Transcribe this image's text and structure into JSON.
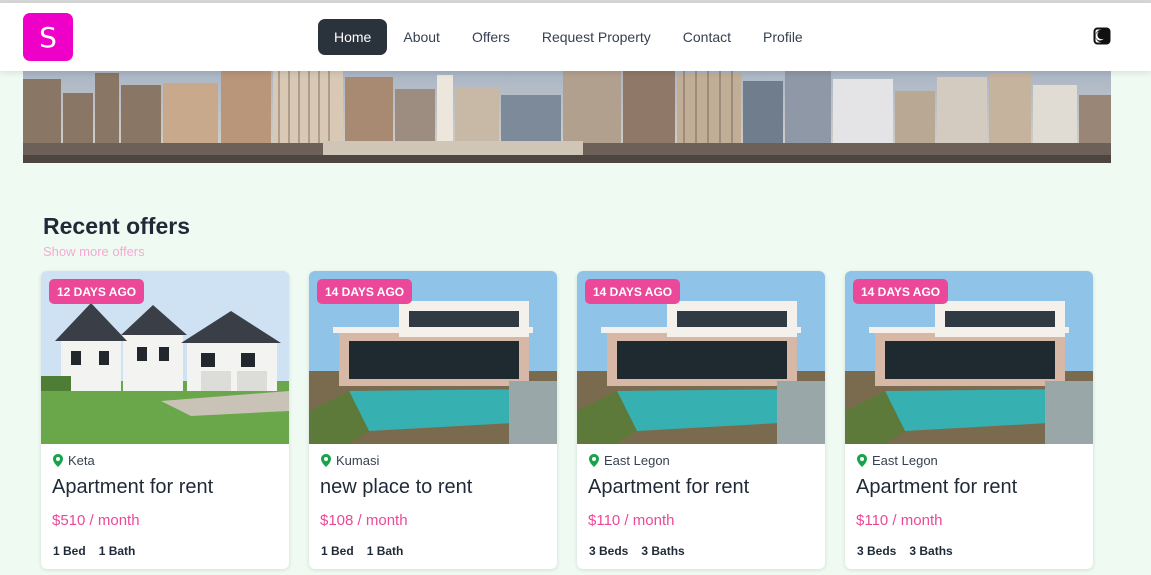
{
  "logo": {
    "letter": "S",
    "color": "#ee00c8"
  },
  "nav": {
    "items": [
      {
        "label": "Home",
        "active": true
      },
      {
        "label": "About"
      },
      {
        "label": "Offers"
      },
      {
        "label": "Request Property"
      },
      {
        "label": "Contact"
      },
      {
        "label": "Profile"
      }
    ],
    "theme_icon": "moon-half-icon"
  },
  "hero": {
    "image": "city-skyline-image"
  },
  "section": {
    "title": "Recent offers",
    "show_more": "Show more offers"
  },
  "cards": [
    {
      "badge": "12 DAYS AGO",
      "location": "Keta",
      "title": "Apartment for rent",
      "price": "$510 / month",
      "beds": "1 Bed",
      "baths": "1 Bath",
      "image": "white-farmhouse-image"
    },
    {
      "badge": "14 DAYS AGO",
      "location": "Kumasi",
      "title": "new place to rent",
      "price": "$108 / month",
      "beds": "1 Bed",
      "baths": "1 Bath",
      "image": "modern-villa-pool-image"
    },
    {
      "badge": "14 DAYS AGO",
      "location": "East Legon",
      "title": "Apartment for rent",
      "price": "$110 / month",
      "beds": "3 Beds",
      "baths": "3 Baths",
      "image": "modern-villa-pool-image"
    },
    {
      "badge": "14 DAYS AGO",
      "location": "East Legon",
      "title": "Apartment for rent",
      "price": "$110 / month",
      "beds": "3 Beds",
      "baths": "3 Baths",
      "image": "modern-villa-pool-image"
    }
  ],
  "colors": {
    "accent": "#ec4899",
    "background": "#effbf2",
    "nav_active": "#2a323c"
  }
}
